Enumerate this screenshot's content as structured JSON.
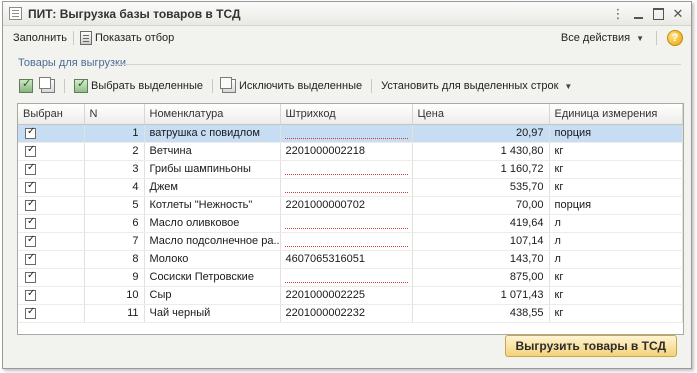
{
  "window": {
    "title": "ПИТ: Выгрузка базы товаров в ТСД"
  },
  "commandbar": {
    "fill_label": "Заполнить",
    "show_filter_label": "Показать отбор",
    "all_actions_label": "Все действия",
    "help_symbol": "?"
  },
  "group": {
    "title": "Товары для выгрузки"
  },
  "toolbar": {
    "select_selected_label": "Выбрать выделенные",
    "exclude_selected_label": "Исключить выделенные",
    "set_for_rows_label": "Установить для выделенных строк"
  },
  "table": {
    "columns": [
      "Выбран",
      "N",
      "Номенклатура",
      "Штрихкод",
      "Цена",
      "Единица измерения"
    ],
    "rows": [
      {
        "checked": true,
        "n": "1",
        "name": "ватрушка с повидлом",
        "barcode": "",
        "price": "20,97",
        "unit": "порция"
      },
      {
        "checked": true,
        "n": "2",
        "name": "Ветчина",
        "barcode": "2201000002218",
        "price": "1 430,80",
        "unit": "кг"
      },
      {
        "checked": true,
        "n": "3",
        "name": "Грибы шампиньоны",
        "barcode": "",
        "price": "1 160,72",
        "unit": "кг"
      },
      {
        "checked": true,
        "n": "4",
        "name": "Джем",
        "barcode": "",
        "price": "535,70",
        "unit": "кг"
      },
      {
        "checked": true,
        "n": "5",
        "name": "Котлеты \"Нежность\"",
        "barcode": "2201000000702",
        "price": "70,00",
        "unit": "порция"
      },
      {
        "checked": true,
        "n": "6",
        "name": "Масло оливковое",
        "barcode": "",
        "price": "419,64",
        "unit": "л"
      },
      {
        "checked": true,
        "n": "7",
        "name": "Масло подсолнечное ра...",
        "barcode": "",
        "price": "107,14",
        "unit": "л"
      },
      {
        "checked": true,
        "n": "8",
        "name": "Молоко",
        "barcode": "4607065316051",
        "price": "143,70",
        "unit": "л"
      },
      {
        "checked": true,
        "n": "9",
        "name": "Сосиски Петровские",
        "barcode": "",
        "price": "875,00",
        "unit": "кг"
      },
      {
        "checked": true,
        "n": "10",
        "name": "Сыр",
        "barcode": "2201000002225",
        "price": "1 071,43",
        "unit": "кг"
      },
      {
        "checked": true,
        "n": "11",
        "name": "Чай черный",
        "barcode": "2201000002232",
        "price": "438,55",
        "unit": "кг"
      }
    ]
  },
  "footer": {
    "export_label": "Выгрузить товары в ТСД"
  },
  "colors": {
    "selected_row": "#c7ddf3",
    "accent": "#4a6d93",
    "button_gold": "#f4d27a",
    "empty_barcode_mark": "#d23b3b"
  }
}
